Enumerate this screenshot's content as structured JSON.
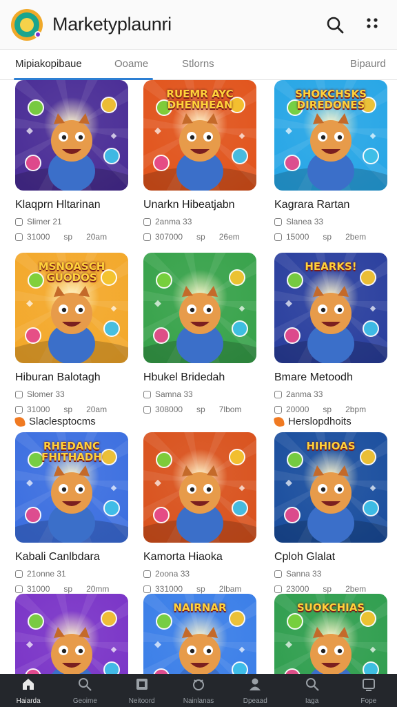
{
  "app": {
    "title": "Marketyplaunri"
  },
  "header": {
    "search_icon": "search-icon",
    "menu_icon": "more-vert-icon"
  },
  "tabs": [
    {
      "label": "Mipiakopibaue",
      "active": true
    },
    {
      "label": "Ooame",
      "active": false
    },
    {
      "label": "Stlorns",
      "active": false
    },
    {
      "label": "Bipaurd",
      "active": false
    }
  ],
  "sections": [
    {
      "label": "Slaclesptocms"
    },
    {
      "label": "Herslopdhoits"
    }
  ],
  "games": [
    {
      "title": "Klaqprn Hltarinan",
      "line1": "Slimer 21",
      "plays": "31000",
      "tag": "sp",
      "time": "20am"
    },
    {
      "title": "Unarkn Hibeatjabn",
      "line1": "2anma 33",
      "plays": "307000",
      "tag": "sp",
      "time": "26em"
    },
    {
      "title": "Kagrara Rartan",
      "line1": "Slanea 33",
      "plays": "15000",
      "tag": "sp",
      "time": "2bem"
    },
    {
      "title": "Hiburan Balotagh",
      "line1": "Slomer 33",
      "plays": "31000",
      "tag": "sp",
      "time": "20am"
    },
    {
      "title": "Hbukel Bridedah",
      "line1": "Samna 33",
      "plays": "308000",
      "tag": "sp",
      "time": "7lbom"
    },
    {
      "title": "Bmare Metoodh",
      "line1": "2anma 33",
      "plays": "20000",
      "tag": "sp",
      "time": "2bpm"
    },
    {
      "title": "Kabali Canlbdara",
      "line1": "21onne 31",
      "plays": "31000",
      "tag": "sp",
      "time": "20mm"
    },
    {
      "title": "Kamorta Hiaoka",
      "line1": "2oona 33",
      "plays": "331000",
      "tag": "sp",
      "time": "2lbam"
    },
    {
      "title": "Cploh Glalat",
      "line1": "Sanna 33",
      "plays": "23000",
      "tag": "sp",
      "time": "2bem"
    },
    {
      "title": "",
      "line1": "",
      "plays": "",
      "tag": "",
      "time": ""
    },
    {
      "title": "",
      "line1": "",
      "plays": "",
      "tag": "",
      "time": ""
    },
    {
      "title": "",
      "line1": "",
      "plays": "",
      "tag": "",
      "time": ""
    }
  ],
  "thumb_text": [
    "",
    "RUEMR AYC DHENHEAN",
    "SHOKCHSKS DIREDONES",
    "MSNOASCH GUODOS",
    "",
    "HEARKS!",
    "RHEDANC FHITHADH",
    "",
    "HIHIOAS",
    "",
    "NAIRNAR",
    "SUOKCHIAS"
  ],
  "bottom_nav": [
    {
      "label": "Haiarda",
      "icon": "home-icon",
      "active": true
    },
    {
      "label": "Geoime",
      "icon": "search-icon",
      "active": false
    },
    {
      "label": "Neitoord",
      "icon": "game-icon",
      "active": false
    },
    {
      "label": "Nainlanas",
      "icon": "controller-icon",
      "active": false
    },
    {
      "label": "Dpeaad",
      "icon": "profile-icon",
      "active": false
    },
    {
      "label": "Iaga",
      "icon": "search-icon",
      "active": false
    },
    {
      "label": "Fope",
      "icon": "tv-icon",
      "active": false
    }
  ],
  "colors": {
    "accent": "#2d7fd3",
    "nav_bg": "#24272c",
    "thumb_bgs": [
      "#4a2d96",
      "#e1541c",
      "#27a6e6",
      "#f3a82a",
      "#37a24a",
      "#2a3f9e",
      "#3c6fe0",
      "#d9521d",
      "#1a4e9e",
      "#7a34c7",
      "#3a7ee8",
      "#2f9e4e"
    ]
  }
}
